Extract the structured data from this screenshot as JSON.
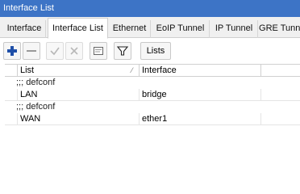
{
  "window": {
    "title": "Interface List"
  },
  "tabs": [
    {
      "label": "Interface",
      "active": false
    },
    {
      "label": "Interface List",
      "active": true
    },
    {
      "label": "Ethernet",
      "active": false
    },
    {
      "label": "EoIP Tunnel",
      "active": false
    },
    {
      "label": "IP Tunnel",
      "active": false
    },
    {
      "label": "GRE Tunnel",
      "active": false
    }
  ],
  "toolbar": {
    "buttons": [
      {
        "icon": "plus-icon",
        "enabled": true
      },
      {
        "icon": "minus-icon",
        "enabled": true
      },
      {
        "icon": "check-icon",
        "enabled": false
      },
      {
        "icon": "x-icon",
        "enabled": false
      },
      {
        "icon": "comment-icon",
        "enabled": true
      },
      {
        "icon": "filter-icon",
        "enabled": true
      }
    ],
    "lists_label": "Lists"
  },
  "table": {
    "columns": [
      "List",
      "Interface"
    ],
    "rows": [
      {
        "type": "comment",
        "text": ";;; defconf"
      },
      {
        "type": "item",
        "list": "LAN",
        "interface": "bridge"
      },
      {
        "type": "comment",
        "text": ";;; defconf"
      },
      {
        "type": "item",
        "list": "WAN",
        "interface": "ether1"
      }
    ]
  },
  "colors": {
    "titlebar": "#3d74c6",
    "plus_icon": "#1f4fa8",
    "disabled_icon": "#b8b8b8"
  }
}
